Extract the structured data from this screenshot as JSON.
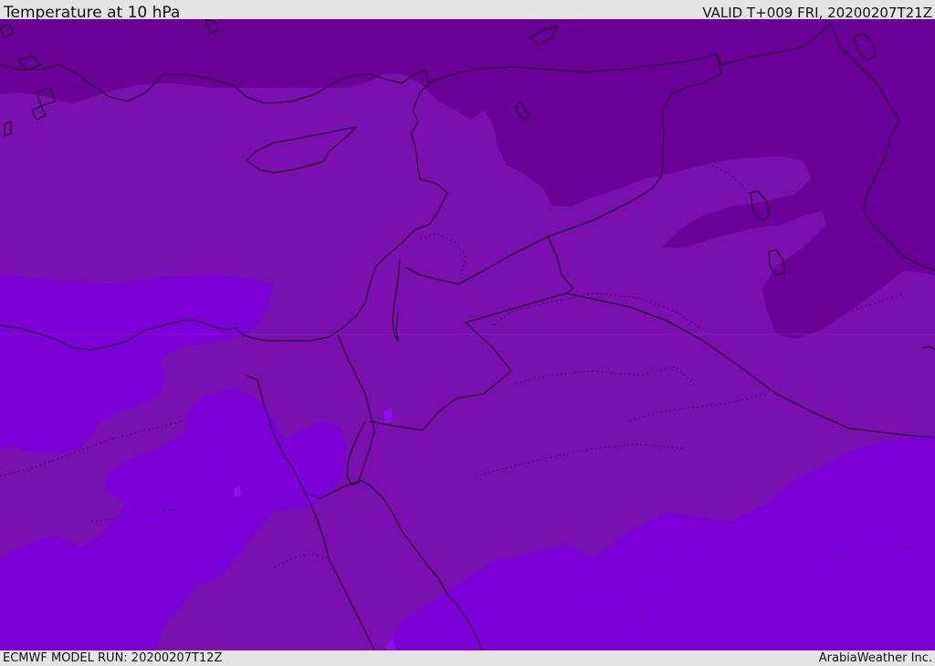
{
  "header": {
    "title": "Temperature at 10 hPa",
    "valid_time": "VALID T+009 FRI, 20200207T21Z"
  },
  "footer": {
    "model_run": "ECMWF MODEL RUN: 20200207T12Z",
    "credit": "ArabiaWeather Inc."
  },
  "map": {
    "field": "temperature",
    "level": "10 hPa",
    "colors": {
      "darkest": "#6a0098",
      "mid": "#7a10b0",
      "bright": "#7d00d8",
      "lighter": "#8a10f0",
      "border": "#111111"
    }
  }
}
